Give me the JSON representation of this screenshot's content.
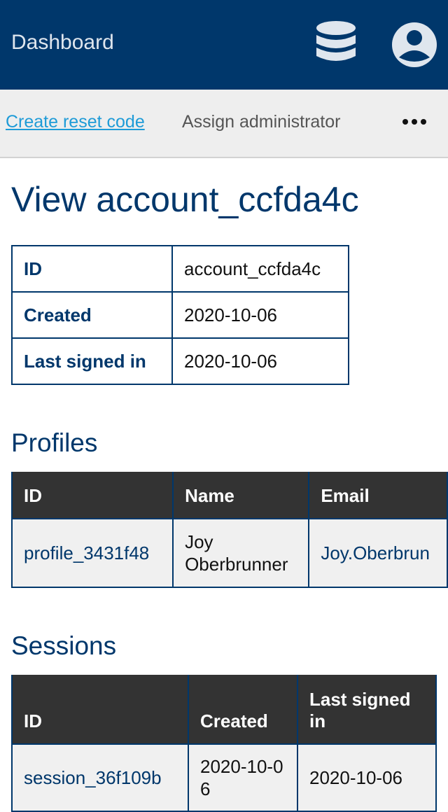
{
  "header": {
    "title": "Dashboard",
    "icons": [
      "database-icon",
      "user-account-icon"
    ],
    "background": "#00376b"
  },
  "actions": {
    "create_reset_code": "Create reset code",
    "assign_administrator": "Assign administrator",
    "more_icon": "more-horizontal-icon"
  },
  "page": {
    "title": "View account_ccfda4c"
  },
  "summary": {
    "rows": [
      {
        "key": "ID",
        "value": "account_ccfda4c"
      },
      {
        "key": "Created",
        "value": "2020-10-06"
      },
      {
        "key": "Last signed in",
        "value": "2020-10-06"
      }
    ]
  },
  "profiles": {
    "title": "Profiles",
    "columns": [
      "ID",
      "Name",
      "Email"
    ],
    "rows": [
      {
        "id": "profile_3431f48",
        "name": "Joy Oberbrunner",
        "email": "Joy.Oberbrun"
      }
    ]
  },
  "sessions": {
    "title": "Sessions",
    "columns": [
      "ID",
      "Created",
      "Last signed in"
    ],
    "rows": [
      {
        "id": "session_36f109b",
        "created": "2020-10-06",
        "last_signed_in": "2020-10-06"
      }
    ]
  },
  "colors": {
    "primary": "#00376b",
    "link": "#1e9bd7",
    "table_header": "#333333",
    "action_bar": "#eeeeee"
  }
}
